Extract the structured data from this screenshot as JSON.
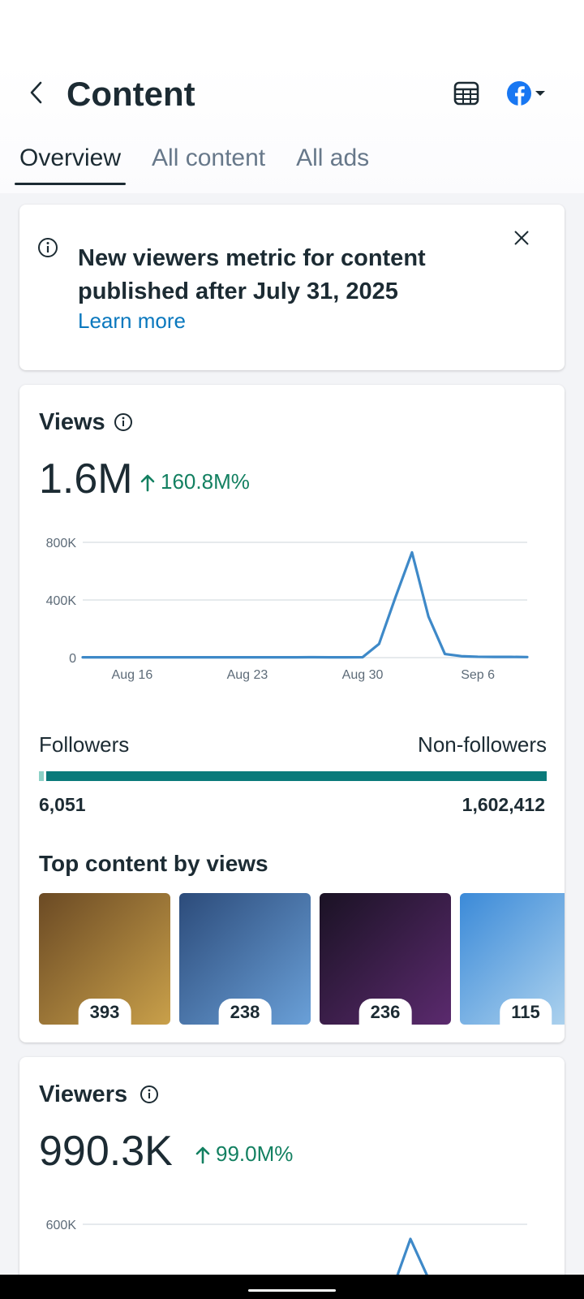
{
  "header": {
    "title": "Content",
    "tabs": [
      {
        "label": "Overview",
        "active": true
      },
      {
        "label": "All content",
        "active": false
      },
      {
        "label": "All ads",
        "active": false
      }
    ]
  },
  "notice": {
    "text": "New viewers metric for content published after July 31, 2025",
    "link": "Learn more"
  },
  "views": {
    "label": "Views",
    "value": "1.6M",
    "delta": "160.8M%",
    "followers_label": "Followers",
    "non_followers_label": "Non-followers",
    "followers_value": "6,051",
    "non_followers_value": "1,602,412",
    "followers_share": 0.0038,
    "top_content_title": "Top content by views",
    "top_content": [
      {
        "views": "393",
        "thumb_colors": [
          "#6b4a24",
          "#c9a04a"
        ]
      },
      {
        "views": "238",
        "thumb_colors": [
          "#2c4b7a",
          "#6aa0d8"
        ]
      },
      {
        "views": "236",
        "thumb_colors": [
          "#1a1224",
          "#5b2a6e"
        ]
      },
      {
        "views": "115",
        "thumb_colors": [
          "#3b8ad8",
          "#b8d9f0"
        ]
      }
    ]
  },
  "viewers": {
    "label": "Viewers",
    "value": "990.3K",
    "delta": "99.0M%"
  },
  "chart_data": [
    {
      "type": "line",
      "title": "",
      "xlabel": "",
      "ylabel": "",
      "x_tick_labels": [
        "Aug 16",
        "Aug 23",
        "Aug 30",
        "Sep 6"
      ],
      "y_tick_labels": [
        "800K",
        "400K",
        "0"
      ],
      "ylim": [
        0,
        800000
      ],
      "grid": true,
      "series_color": "#3e89c8",
      "x": [
        "Aug 13",
        "Aug 14",
        "Aug 15",
        "Aug 16",
        "Aug 17",
        "Aug 18",
        "Aug 19",
        "Aug 20",
        "Aug 21",
        "Aug 22",
        "Aug 23",
        "Aug 24",
        "Aug 25",
        "Aug 26",
        "Aug 27",
        "Aug 28",
        "Aug 29",
        "Aug 30",
        "Aug 31",
        "Sep 1",
        "Sep 2",
        "Sep 3",
        "Sep 4",
        "Sep 5",
        "Sep 6",
        "Sep 7",
        "Sep 8",
        "Sep 9"
      ],
      "values": [
        2000,
        2000,
        2000,
        2000,
        2000,
        2000,
        2000,
        2000,
        2000,
        2000,
        2000,
        2000,
        2000,
        2000,
        3000,
        2000,
        2000,
        3000,
        95000,
        420000,
        730000,
        285000,
        25000,
        10000,
        6000,
        5000,
        5000,
        4000
      ]
    },
    {
      "type": "line",
      "title": "",
      "xlabel": "",
      "ylabel": "",
      "y_tick_labels": [
        "600K"
      ],
      "grid": true,
      "series_color": "#3e89c8",
      "partial": true
    }
  ]
}
